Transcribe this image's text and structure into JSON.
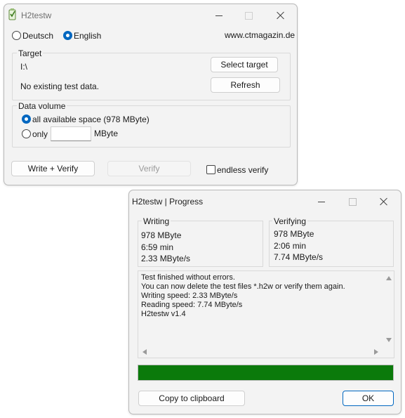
{
  "main": {
    "title": "H2testw",
    "lang_de": "Deutsch",
    "lang_en": "English",
    "site": "www.ctmagazin.de",
    "target_group": "Target",
    "drive": "I:\\",
    "status": "No existing test data.",
    "select_target": "Select target",
    "refresh": "Refresh",
    "volume_group": "Data volume",
    "opt_all": "all available space (978 MByte)",
    "opt_only": "only",
    "only_value": "",
    "unit": "MByte",
    "write_verify": "Write + Verify",
    "verify": "Verify",
    "endless_verify": "endless verify",
    "selected_language": "English",
    "selected_volume": "all available space"
  },
  "progress": {
    "title": "H2testw | Progress",
    "writing_title": "Writing",
    "writing_size": "978 MByte",
    "writing_time": "6:59 min",
    "writing_speed": "2.33 MByte/s",
    "verifying_title": "Verifying",
    "verifying_size": "978 MByte",
    "verifying_time": "2:06 min",
    "verifying_speed": "7.74 MByte/s",
    "log": [
      "Test finished without errors.",
      "You can now delete the test files *.h2w or verify them again.",
      "Writing speed: 2.33 MByte/s",
      "Reading speed: 7.74 MByte/s",
      "H2testw v1.4"
    ],
    "percent": 100,
    "bar_color": "#0b7a0b",
    "copy": "Copy to clipboard",
    "ok": "OK"
  },
  "colors": {
    "accent": "#0067c0",
    "window_bg": "#f3f3f3"
  }
}
